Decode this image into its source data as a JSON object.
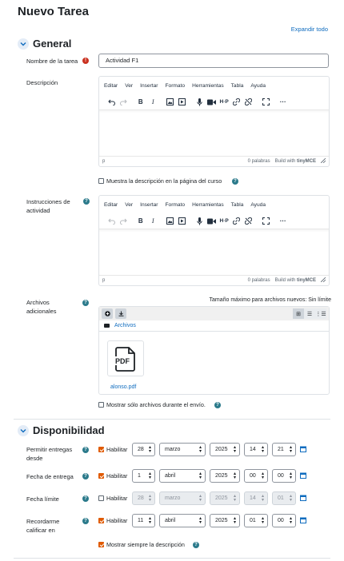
{
  "page_title": "Nuevo Tarea",
  "expand_all": "Expandir todo",
  "general": {
    "title": "General",
    "name_label": "Nombre de la tarea",
    "name_value": "Actividad F1",
    "description_label": "Descripción",
    "instructions_label": "Instrucciones de actividad",
    "show_description_label": "Muestra la descripción en la página del curso",
    "files_label": "Archivos adicionales",
    "max_size": "Tamaño máximo para archivos nuevos: Sin límite",
    "files_path": "Archivos",
    "file_name": "alonso.pdf",
    "file_type": "PDF",
    "show_files_label": "Mostrar sólo archivos durante el envío."
  },
  "editor": {
    "menu": [
      "Editar",
      "Ver",
      "Insertar",
      "Formato",
      "Herramientas",
      "Tabla",
      "Ayuda"
    ],
    "path": "p",
    "word_count": "0 palabras",
    "built_with": "Build with",
    "brand": "tinyMCE"
  },
  "availability": {
    "title": "Disponibilidad",
    "enable_label": "Habilitar",
    "rows": [
      {
        "label": "Permitir entregas desde",
        "enabled": true,
        "day": "28",
        "month": "marzo",
        "year": "2025",
        "hour": "14",
        "minute": "21"
      },
      {
        "label": "Fecha de entrega",
        "enabled": true,
        "day": "1",
        "month": "abril",
        "year": "2025",
        "hour": "00",
        "minute": "00"
      },
      {
        "label": "Fecha límite",
        "enabled": false,
        "day": "28",
        "month": "marzo",
        "year": "2025",
        "hour": "14",
        "minute": "01"
      },
      {
        "label": "Recordarme calificar en",
        "enabled": true,
        "day": "11",
        "month": "abril",
        "year": "2025",
        "hour": "01",
        "minute": "00"
      }
    ],
    "always_show_label": "Mostrar siempre la descripción"
  },
  "colors": {
    "accent": "#0f6cbf",
    "required": "#ca3120",
    "help": "#2b7a8b",
    "checkbox": "#e05a00"
  }
}
